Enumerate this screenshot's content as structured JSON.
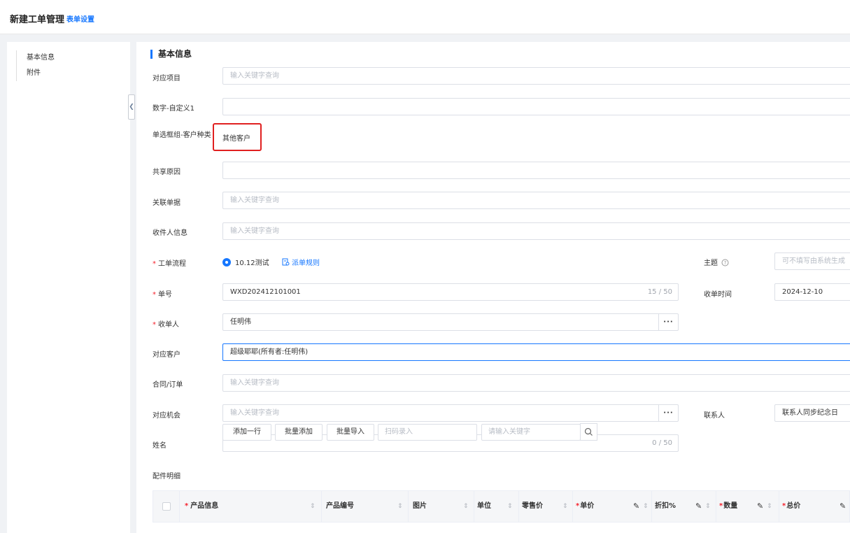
{
  "header": {
    "title": "新建工单管理",
    "settings_link": "表单设置"
  },
  "sidebar": {
    "items": [
      {
        "label": "基本信息"
      },
      {
        "label": "附件"
      }
    ]
  },
  "section": {
    "title": "基本信息"
  },
  "fields": {
    "project": {
      "label": "对应项目",
      "placeholder": "输入关键字查询"
    },
    "number_custom": {
      "label": "数字-自定义1",
      "value": ""
    },
    "customer_type": {
      "label": "单选框组-客户种类",
      "value": "其他客户"
    },
    "share_reason": {
      "label": "共享原因",
      "value": ""
    },
    "related_doc": {
      "label": "关联单据",
      "placeholder": "输入关键字查询"
    },
    "recipient_info": {
      "label": "收件人信息",
      "placeholder": "输入关键字查询"
    },
    "workflow": {
      "label": "工单流程",
      "option": "10.12测试",
      "rule_link": "派单规则"
    },
    "subject": {
      "label": "主题",
      "placeholder": "可不填写由系统生成"
    },
    "order_no": {
      "label": "单号",
      "value": "WXD202412101001",
      "count": "15 / 50"
    },
    "receive_time": {
      "label": "收单时间",
      "value": "2024-12-10"
    },
    "receiver": {
      "label": "收单人",
      "value": "任明伟",
      "more": "···"
    },
    "customer": {
      "label": "对应客户",
      "value": "超级耶耶(所有者:任明伟)"
    },
    "contract": {
      "label": "合同/订单",
      "placeholder": "输入关键字查询"
    },
    "opportunity": {
      "label": "对应机会",
      "placeholder": "输入关键字查询",
      "more": "···"
    },
    "contact": {
      "label": "联系人",
      "value": "联系人同步纪念日"
    },
    "name": {
      "label": "姓名",
      "value": "",
      "count": "0 / 50"
    },
    "parts": {
      "label": "配件明细",
      "add_row": "添加一行",
      "batch_add": "批量添加",
      "batch_import": "批量导入",
      "scan_placeholder": "扫码录入",
      "search_placeholder": "请输入关键字"
    }
  },
  "table": {
    "columns": [
      {
        "label": "产品信息",
        "required": true
      },
      {
        "label": "产品编号",
        "required": false
      },
      {
        "label": "图片",
        "required": false
      },
      {
        "label": "单位",
        "required": false
      },
      {
        "label": "零售价",
        "required": false
      },
      {
        "label": "单价",
        "required": true
      },
      {
        "label": "折扣%",
        "required": false
      },
      {
        "label": "数量",
        "required": true
      },
      {
        "label": "总价",
        "required": true
      }
    ]
  },
  "icons": [
    "collapse-left-icon",
    "help-circle-icon",
    "rule-doc-icon",
    "search-icon",
    "sort-icon",
    "edit-pen-icon",
    "more-dots-icon"
  ],
  "colors": {
    "accent": "#1677ff",
    "required": "#f5222d",
    "highlight_box": "#e02020"
  }
}
